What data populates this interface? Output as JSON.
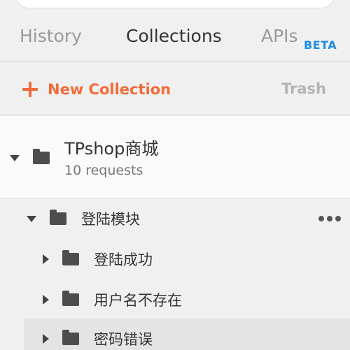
{
  "tabs": {
    "history": "History",
    "collections": "Collections",
    "apis": "APIs",
    "apis_badge": "BETA",
    "active": "Collections"
  },
  "toolbar": {
    "new_collection": "New Collection",
    "trash": "Trash"
  },
  "collection": {
    "name": "TPshop商城",
    "count": "10 requests",
    "expanded": true
  },
  "folders": [
    {
      "label": "登陆模块",
      "expanded": true
    },
    {
      "label": "登陆成功",
      "expanded": false
    },
    {
      "label": "用户名不存在",
      "expanded": false
    },
    {
      "label": "密码错误",
      "expanded": false,
      "selected": true
    }
  ],
  "colors": {
    "accent": "#f26b3a",
    "badge": "#1f8ce0",
    "muted": "#9a9a9a"
  },
  "icons": [
    "plus-icon",
    "caret-down-icon",
    "caret-right-icon",
    "folder-icon",
    "more-options-icon"
  ]
}
